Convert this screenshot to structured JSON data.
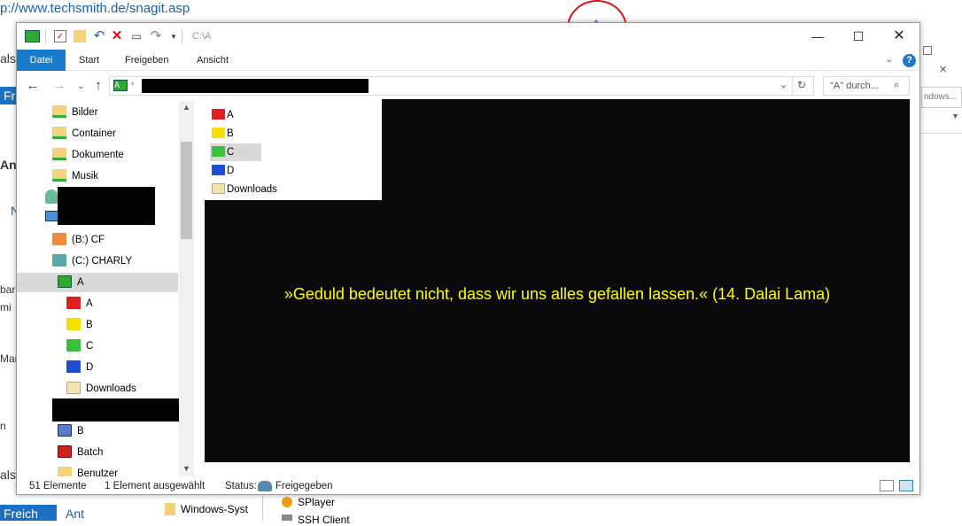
{
  "background": {
    "url": "p://www.techsmith.de/snagit.asp",
    "fragments": {
      "left1": "als",
      "left2": "Ant",
      "left3": "N",
      "left4": "bard",
      "left5": "mi",
      "left6": "Mar",
      "left7": "n",
      "left8": "als",
      "blue_btn1": "Freil",
      "blue_btn2": "Freich",
      "ant_bottom": "Ant",
      "right_windows": "ndows...",
      "taskbar_item": "Windows-Syst",
      "splayer": "SPlayer",
      "ssl": "SSH Client"
    }
  },
  "window": {
    "title": "C:\\A",
    "ribbon_tabs": [
      "Datei",
      "Start",
      "Freigeben",
      "Ansicht"
    ],
    "address_root": "A",
    "search_placeholder": "\"A\" durch...",
    "nav_tree": {
      "items": [
        "Bilder",
        "Container",
        "Dokumente",
        "Musik"
      ],
      "drives": [
        "(B:) CF",
        "(C:) CHARLY"
      ],
      "current": "A",
      "children": [
        "A",
        "B",
        "C",
        "D",
        "Downloads"
      ],
      "more": [
        "B",
        "Batch",
        "Benutzer"
      ]
    },
    "files": [
      "A",
      "B",
      "C",
      "D",
      "Downloads"
    ],
    "quote": "»Geduld bedeutet nicht, dass wir uns alles gefallen lassen.« (14. Dalai Lama)",
    "status": {
      "count": "51 Elemente",
      "selected": "1 Element ausgewählt",
      "status_label": "Status:",
      "status_value": "Freigegeben"
    }
  },
  "colors": {
    "accent": "#1979ca",
    "quote": "#ffff00",
    "annotation_circle": "#e01010"
  }
}
